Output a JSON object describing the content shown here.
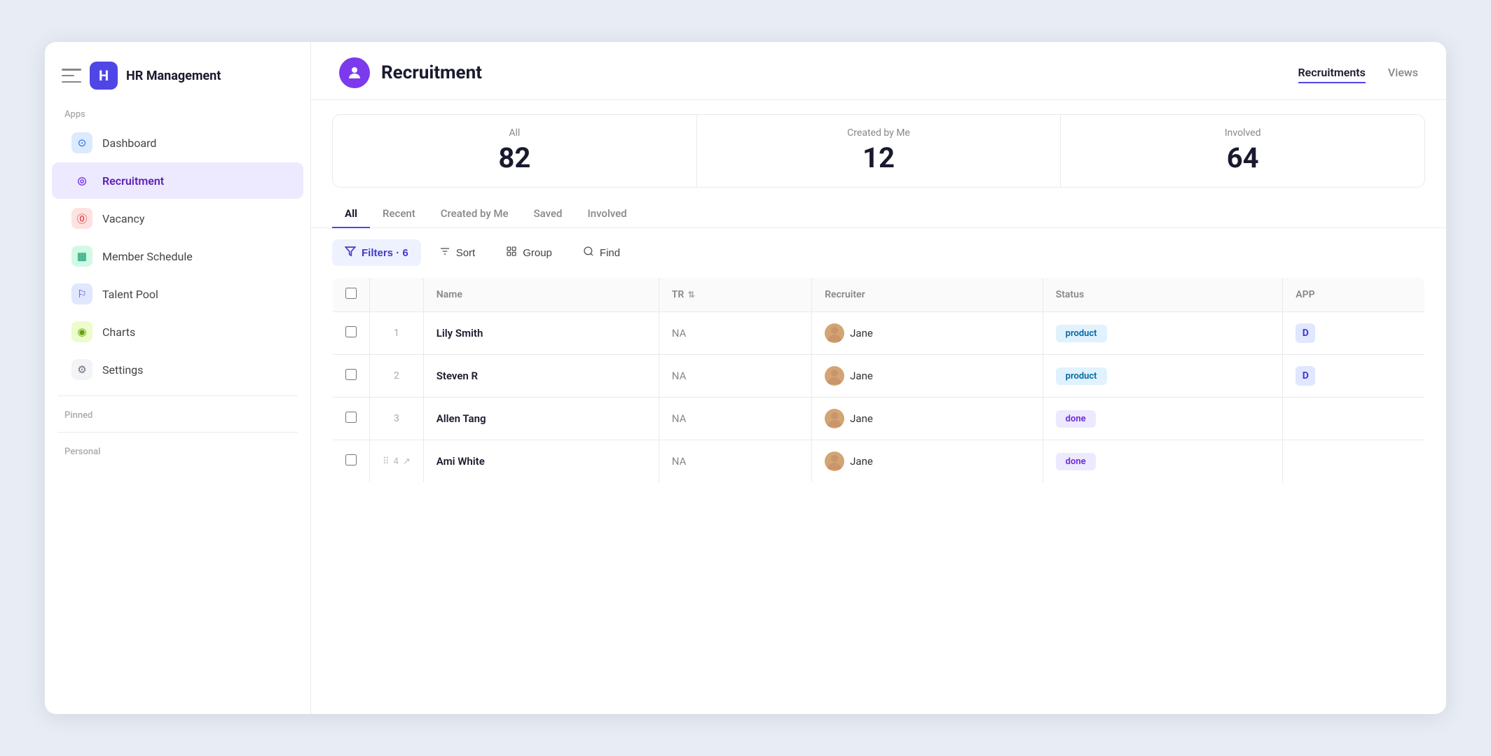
{
  "app": {
    "title": "HR Management",
    "logo_letter": "H"
  },
  "sidebar": {
    "section_apps": "Apps",
    "section_pinned": "Pinned",
    "section_personal": "Personal",
    "items": [
      {
        "id": "dashboard",
        "label": "Dashboard",
        "icon_color": "blue",
        "icon": "⊙"
      },
      {
        "id": "recruitment",
        "label": "Recruitment",
        "icon_color": "purple",
        "icon": "◎",
        "active": true
      },
      {
        "id": "vacancy",
        "label": "Vacancy",
        "icon_color": "red",
        "icon": "⓪"
      },
      {
        "id": "member-schedule",
        "label": "Member Schedule",
        "icon_color": "green",
        "icon": "▦"
      },
      {
        "id": "talent-pool",
        "label": "Talent Pool",
        "icon_color": "indigo",
        "icon": "⚐"
      },
      {
        "id": "charts",
        "label": "Charts",
        "icon_color": "lime",
        "icon": "◉"
      },
      {
        "id": "settings",
        "label": "Settings",
        "icon_color": "gray",
        "icon": "⚙"
      }
    ]
  },
  "header": {
    "page_title": "Recruitment",
    "page_icon": "👤",
    "nav_items": [
      {
        "label": "Recruitments",
        "active": true
      },
      {
        "label": "Views",
        "active": false
      }
    ]
  },
  "stats": [
    {
      "label": "All",
      "value": "82"
    },
    {
      "label": "Created by Me",
      "value": "12"
    },
    {
      "label": "Involved",
      "value": "64"
    }
  ],
  "tabs": [
    {
      "label": "All",
      "active": true
    },
    {
      "label": "Recent",
      "active": false
    },
    {
      "label": "Created by Me",
      "active": false
    },
    {
      "label": "Saved",
      "active": false
    },
    {
      "label": "Involved",
      "active": false
    }
  ],
  "toolbar": {
    "filter_label": "Filters · 6",
    "sort_label": "Sort",
    "group_label": "Group",
    "find_label": "Find"
  },
  "table": {
    "columns": [
      {
        "id": "checkbox",
        "label": ""
      },
      {
        "id": "row_num",
        "label": ""
      },
      {
        "id": "name",
        "label": "Name"
      },
      {
        "id": "tr",
        "label": "TR"
      },
      {
        "id": "recruiter",
        "label": "Recruiter"
      },
      {
        "id": "status",
        "label": "Status"
      },
      {
        "id": "app",
        "label": "APP"
      }
    ],
    "rows": [
      {
        "num": "1",
        "name": "Lily Smith",
        "tr": "NA",
        "recruiter": "Jane",
        "status": "product",
        "status_type": "product",
        "app": "D",
        "row_actions": false
      },
      {
        "num": "2",
        "name": "Steven R",
        "tr": "NA",
        "recruiter": "Jane",
        "status": "product",
        "status_type": "product",
        "app": "D",
        "row_actions": false
      },
      {
        "num": "3",
        "name": "Allen Tang",
        "tr": "NA",
        "recruiter": "Jane",
        "status": "done",
        "status_type": "done",
        "app": "",
        "row_actions": false
      },
      {
        "num": "4",
        "name": "Ami White",
        "tr": "NA",
        "recruiter": "Jane",
        "status": "done",
        "status_type": "done",
        "app": "",
        "row_actions": true
      }
    ]
  }
}
